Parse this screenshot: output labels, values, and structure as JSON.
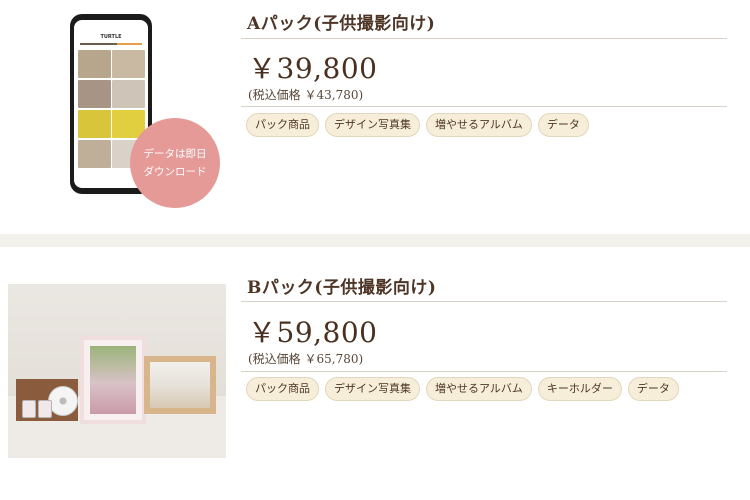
{
  "packs": [
    {
      "title": "Aパック(子供撮影向け)",
      "price": "￥39,800",
      "tax": "(税込価格 ￥43,780)",
      "tags": [
        "パック商品",
        "デザイン写真集",
        "増やせるアルバム",
        "データ"
      ],
      "badge": [
        "データは即日",
        "ダウンロード"
      ],
      "phone_brand": "TURTLE"
    },
    {
      "title": "Bパック(子供撮影向け)",
      "price": "￥59,800",
      "tax": "(税込価格 ￥65,780)",
      "tags": [
        "パック商品",
        "デザイン写真集",
        "増やせるアルバム",
        "キーホルダー",
        "データ"
      ]
    }
  ],
  "colors": {
    "badge": "#e69a97",
    "tag_bg": "#f6eed8",
    "text": "#4e3526",
    "page_bg": "#f3f1ec"
  }
}
